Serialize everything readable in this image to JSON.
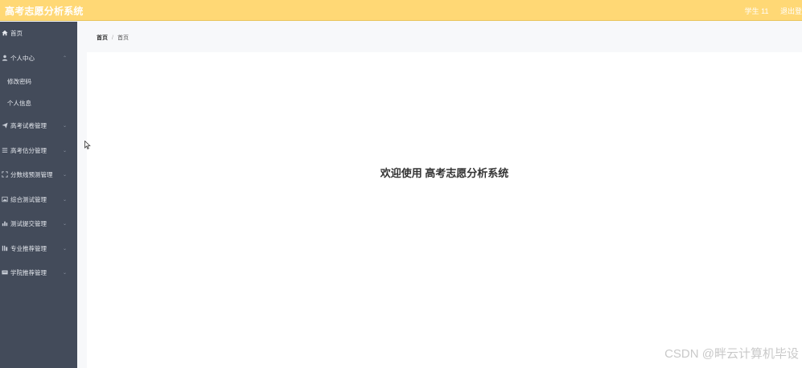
{
  "header": {
    "app_title": "高考志愿分析系统",
    "user_label": "学生 11",
    "logout_label": "退出登"
  },
  "sidebar": {
    "items": [
      {
        "label": "首页",
        "icon": "home-icon"
      },
      {
        "label": "个人中心",
        "icon": "user-icon",
        "expanded": true
      },
      {
        "label": "修改密码"
      },
      {
        "label": "个人信息"
      },
      {
        "label": "高考试卷管理",
        "icon": "send-icon"
      },
      {
        "label": "高考估分管理",
        "icon": "list-icon"
      },
      {
        "label": "分数线预测管理",
        "icon": "expand-icon"
      },
      {
        "label": "综合测试管理",
        "icon": "image-icon"
      },
      {
        "label": "测试提交管理",
        "icon": "bar-chart-icon"
      },
      {
        "label": "专业推荐管理",
        "icon": "columns-icon"
      },
      {
        "label": "学院推荐管理",
        "icon": "card-icon"
      }
    ]
  },
  "breadcrumb": {
    "home": "首页",
    "separator": "/",
    "current": "首页"
  },
  "main": {
    "welcome": "欢迎使用 高考志愿分析系统"
  },
  "watermark": "CSDN @畔云计算机毕设",
  "colors": {
    "topbar": "#ffd875",
    "sidebar": "#434b5a",
    "content_bg": "#f7f8fa"
  }
}
